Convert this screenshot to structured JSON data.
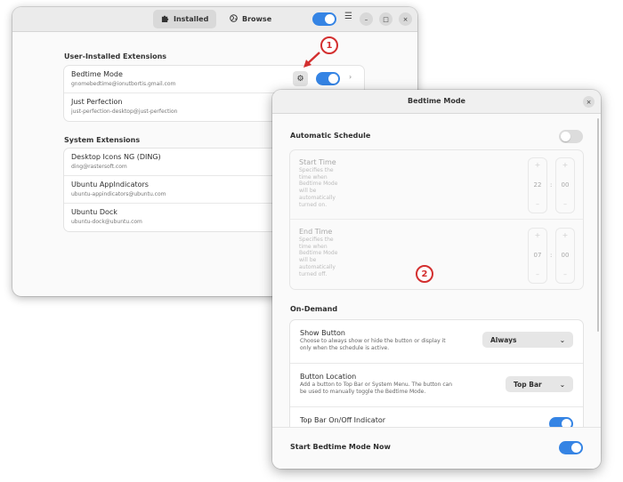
{
  "extensions_window": {
    "tabs": [
      {
        "label": "Installed",
        "icon": "puzzle-icon"
      },
      {
        "label": "Browse",
        "icon": "globe-icon"
      }
    ],
    "window_controls": [
      "–",
      "□",
      "×"
    ],
    "user_section_title": "User-Installed Extensions",
    "user_extensions": [
      {
        "name": "Bedtime Mode",
        "uuid": "gnomebedtime@ionutbortis.gmail.com"
      },
      {
        "name": "Just Perfection",
        "uuid": "just-perfection-desktop@just-perfection"
      }
    ],
    "system_section_title": "System Extensions",
    "system_extensions": [
      {
        "name": "Desktop Icons NG (DING)",
        "uuid": "ding@rastersoft.com"
      },
      {
        "name": "Ubuntu AppIndicators",
        "uuid": "ubuntu-appindicators@ubuntu.com"
      },
      {
        "name": "Ubuntu Dock",
        "uuid": "ubuntu-dock@ubuntu.com"
      }
    ]
  },
  "bedtime_dialog": {
    "title": "Bedtime Mode",
    "close_glyph": "×",
    "automatic_schedule": {
      "title": "Automatic Schedule",
      "enabled": false,
      "start": {
        "label": "Start Time",
        "desc": "Specifies the time when Bedtime Mode will be automatically turned on.",
        "hour": "22",
        "minute": "00"
      },
      "end": {
        "label": "End Time",
        "desc": "Specifies the time when Bedtime Mode will be automatically turned off.",
        "hour": "07",
        "minute": "00"
      },
      "separator": ":",
      "plus": "+",
      "minus": "–"
    },
    "on_demand": {
      "title": "On-Demand",
      "show_button": {
        "title": "Show Button",
        "desc": "Choose to always show or hide the button or display it only when the schedule is active.",
        "value": "Always"
      },
      "button_location": {
        "title": "Button Location",
        "desc": "Add a button to Top Bar or System Menu. The button can be used to manually toggle the Bedtime Mode.",
        "value": "Top Bar"
      },
      "indicator": {
        "title": "Top Bar On/Off Indicator",
        "enabled": true
      }
    },
    "start_now": {
      "label": "Start Bedtime Mode Now",
      "enabled": true
    }
  },
  "annotations": {
    "marker1": "1",
    "marker2": "2"
  },
  "colors": {
    "accent": "#3584e4",
    "annotation": "#d32f2f"
  }
}
